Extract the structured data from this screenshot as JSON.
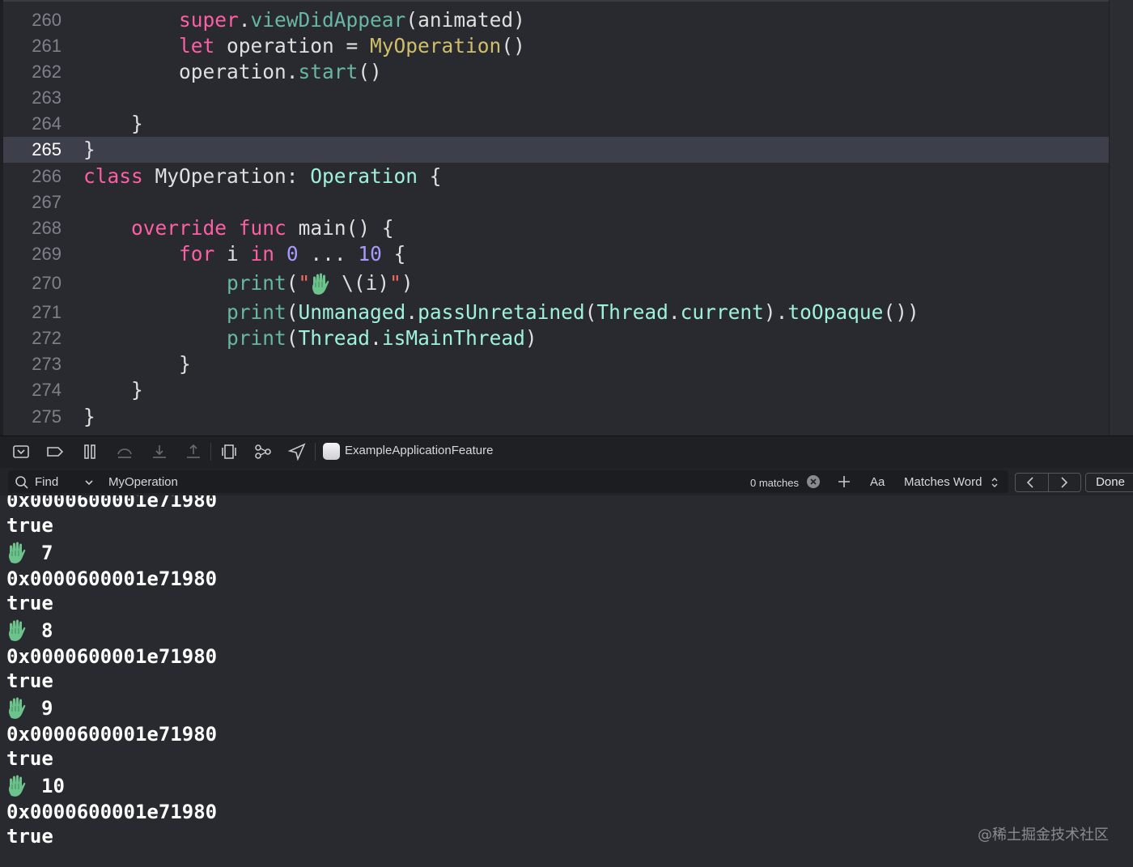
{
  "editor": {
    "current_line": "265",
    "lines": [
      {
        "num": "260",
        "tokens": [
          {
            "t": "        ",
            "c": "plain"
          },
          {
            "t": "super",
            "c": "kw"
          },
          {
            "t": ".",
            "c": "plain"
          },
          {
            "t": "viewDidAppear",
            "c": "fn"
          },
          {
            "t": "(animated)",
            "c": "plain"
          }
        ]
      },
      {
        "num": "261",
        "tokens": [
          {
            "t": "        ",
            "c": "plain"
          },
          {
            "t": "let",
            "c": "kw"
          },
          {
            "t": " operation = ",
            "c": "plain"
          },
          {
            "t": "MyOperation",
            "c": "num"
          },
          {
            "t": "()",
            "c": "plain"
          }
        ]
      },
      {
        "num": "262",
        "tokens": [
          {
            "t": "        operation.",
            "c": "plain"
          },
          {
            "t": "start",
            "c": "fn"
          },
          {
            "t": "()",
            "c": "plain"
          }
        ]
      },
      {
        "num": "263",
        "tokens": []
      },
      {
        "num": "264",
        "tokens": [
          {
            "t": "    }",
            "c": "plain"
          }
        ]
      },
      {
        "num": "265",
        "tokens": [
          {
            "t": "}",
            "c": "plain"
          }
        ]
      },
      {
        "num": "266",
        "tokens": [
          {
            "t": "class",
            "c": "kw"
          },
          {
            "t": " MyOperation: ",
            "c": "plain"
          },
          {
            "t": "Operation",
            "c": "type"
          },
          {
            "t": " {",
            "c": "plain"
          }
        ]
      },
      {
        "num": "267",
        "tokens": []
      },
      {
        "num": "268",
        "tokens": [
          {
            "t": "    ",
            "c": "plain"
          },
          {
            "t": "override",
            "c": "kw"
          },
          {
            "t": " ",
            "c": "plain"
          },
          {
            "t": "func",
            "c": "kw"
          },
          {
            "t": " main() {",
            "c": "plain"
          }
        ]
      },
      {
        "num": "269",
        "tokens": [
          {
            "t": "        ",
            "c": "plain"
          },
          {
            "t": "for",
            "c": "kw"
          },
          {
            "t": " i ",
            "c": "plain"
          },
          {
            "t": "in",
            "c": "kw"
          },
          {
            "t": " ",
            "c": "plain"
          },
          {
            "t": "0",
            "c": "num2"
          },
          {
            "t": " ... ",
            "c": "plain"
          },
          {
            "t": "10",
            "c": "num2"
          },
          {
            "t": " {",
            "c": "plain"
          }
        ]
      },
      {
        "num": "270",
        "tokens": [
          {
            "t": "            ",
            "c": "plain"
          },
          {
            "t": "print",
            "c": "fn"
          },
          {
            "t": "(",
            "c": "plain"
          },
          {
            "t": "\"",
            "c": "str"
          },
          {
            "t": "HAND",
            "c": "emoji"
          },
          {
            "t": " ",
            "c": "str"
          },
          {
            "t": "\\(",
            "c": "plain"
          },
          {
            "t": "i",
            "c": "plain"
          },
          {
            "t": ")",
            "c": "plain"
          },
          {
            "t": "\"",
            "c": "str"
          },
          {
            "t": ")",
            "c": "plain"
          }
        ]
      },
      {
        "num": "271",
        "tokens": [
          {
            "t": "            ",
            "c": "plain"
          },
          {
            "t": "print",
            "c": "fn"
          },
          {
            "t": "(",
            "c": "plain"
          },
          {
            "t": "Unmanaged",
            "c": "type"
          },
          {
            "t": ".",
            "c": "plain"
          },
          {
            "t": "passUnretained",
            "c": "type"
          },
          {
            "t": "(",
            "c": "plain"
          },
          {
            "t": "Thread",
            "c": "type"
          },
          {
            "t": ".",
            "c": "plain"
          },
          {
            "t": "current",
            "c": "type"
          },
          {
            "t": ").",
            "c": "plain"
          },
          {
            "t": "toOpaque",
            "c": "type"
          },
          {
            "t": "())",
            "c": "plain"
          }
        ]
      },
      {
        "num": "272",
        "tokens": [
          {
            "t": "            ",
            "c": "plain"
          },
          {
            "t": "print",
            "c": "fn"
          },
          {
            "t": "(",
            "c": "plain"
          },
          {
            "t": "Thread",
            "c": "type"
          },
          {
            "t": ".",
            "c": "plain"
          },
          {
            "t": "isMainThread",
            "c": "type"
          },
          {
            "t": ")",
            "c": "plain"
          }
        ]
      },
      {
        "num": "273",
        "tokens": [
          {
            "t": "        }",
            "c": "plain"
          }
        ]
      },
      {
        "num": "274",
        "tokens": [
          {
            "t": "    }",
            "c": "plain"
          }
        ]
      },
      {
        "num": "275",
        "tokens": [
          {
            "t": "}",
            "c": "plain"
          }
        ]
      }
    ]
  },
  "debug_bar": {
    "target_label": "ExampleApplicationFeature",
    "icons": [
      "hide-debug-area-icon",
      "breakpoints-toggle-icon",
      "pause-icon",
      "step-over-icon",
      "step-into-icon",
      "step-out-icon",
      "view-hierarchy-icon",
      "memory-graph-icon",
      "simulate-location-icon"
    ]
  },
  "find_bar": {
    "mode_label": "Find",
    "query": "MyOperation",
    "matches_label": "0 matches",
    "case_label": "Aa",
    "match_type": "Matches Word",
    "done_label": "Done"
  },
  "console": {
    "lines": [
      {
        "type": "text",
        "text": "0x0000600001e71980"
      },
      {
        "type": "text",
        "text": "true"
      },
      {
        "type": "hand",
        "text": "7"
      },
      {
        "type": "text",
        "text": "0x0000600001e71980"
      },
      {
        "type": "text",
        "text": "true"
      },
      {
        "type": "hand",
        "text": "8"
      },
      {
        "type": "text",
        "text": "0x0000600001e71980"
      },
      {
        "type": "text",
        "text": "true"
      },
      {
        "type": "hand",
        "text": "9"
      },
      {
        "type": "text",
        "text": "0x0000600001e71980"
      },
      {
        "type": "text",
        "text": "true"
      },
      {
        "type": "hand",
        "text": "10"
      },
      {
        "type": "text",
        "text": "0x0000600001e71980"
      },
      {
        "type": "text",
        "text": "true"
      }
    ]
  },
  "watermark": "@稀土掘金技术社区",
  "colors": {
    "keyword": "#fc5fa3",
    "function": "#67b7a4",
    "type": "#9ef1dd",
    "number": "#a89afc",
    "background": "#292a30"
  }
}
